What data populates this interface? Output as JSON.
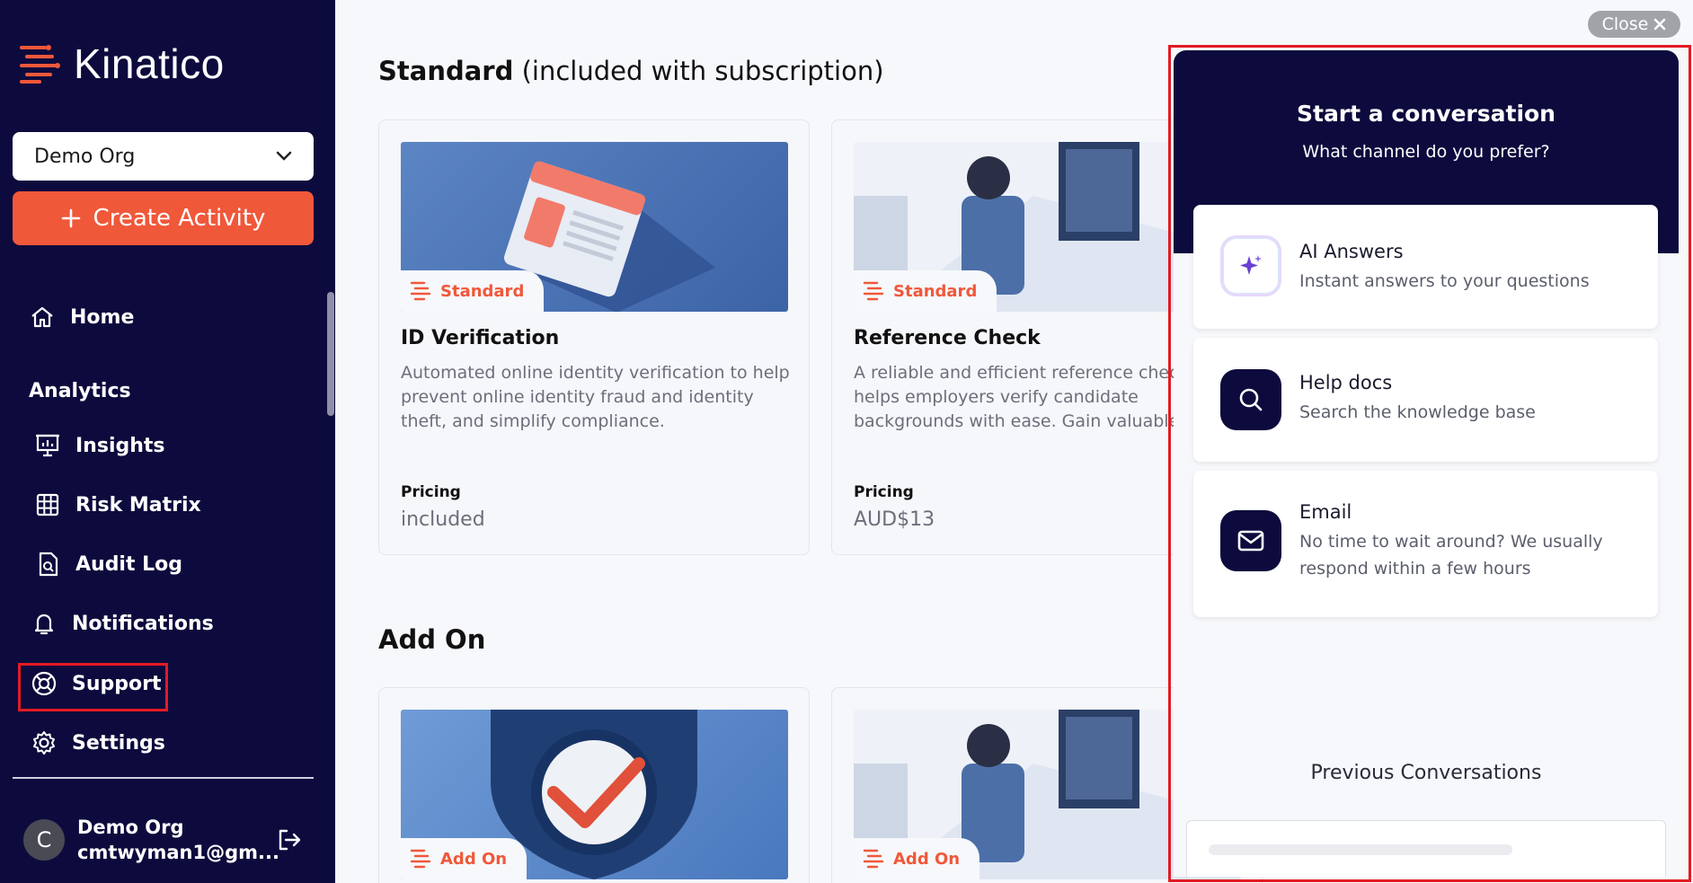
{
  "brand": {
    "name": "Kinatico"
  },
  "sidebar": {
    "org_select": {
      "value": "Demo Org"
    },
    "create_button": {
      "label": "Create Activity"
    },
    "home": {
      "label": "Home"
    },
    "analytics_section": "Analytics",
    "items": [
      {
        "label": "Insights",
        "icon": "presentation-chart-icon"
      },
      {
        "label": "Risk Matrix",
        "icon": "grid-icon"
      },
      {
        "label": "Audit Log",
        "icon": "document-search-icon"
      },
      {
        "label": "Notifications",
        "icon": "bell-icon"
      },
      {
        "label": "Support",
        "icon": "lifebuoy-icon"
      },
      {
        "label": "Settings",
        "icon": "gear-icon"
      }
    ],
    "user": {
      "initial": "C",
      "name": "Demo Org",
      "email": "cmtwyman1@gm..."
    }
  },
  "main": {
    "standard_section": {
      "title_bold": "Standard",
      "title_rest": " (included with subscription)"
    },
    "addon_section": {
      "title": "Add On"
    },
    "cards": [
      {
        "badge": "Standard",
        "title": "ID Verification",
        "description": "Automated online identity verification to help prevent online identity fraud and identity theft, and simplify compliance.",
        "pricing_label": "Pricing",
        "pricing_value": "included"
      },
      {
        "badge": "Standard",
        "title": "Reference Check",
        "description": "A reliable and efficient reference check that helps employers verify candidate backgrounds with ease. Gain valuable",
        "pricing_label": "Pricing",
        "pricing_value": "AUD$13"
      }
    ],
    "addon_cards": [
      {
        "badge": "Add On"
      },
      {
        "badge": "Add On"
      }
    ]
  },
  "close_button": {
    "label": "Close"
  },
  "panel": {
    "title": "Start a conversation",
    "subtitle": "What channel do you prefer?",
    "options": [
      {
        "title": "AI Answers",
        "description": "Instant answers to your questions",
        "icon": "sparkle-icon"
      },
      {
        "title": "Help docs",
        "description": "Search the knowledge base",
        "icon": "search-icon"
      },
      {
        "title": "Email",
        "description": "No time to wait around? We usually respond within a few hours",
        "icon": "envelope-icon"
      }
    ],
    "previous_title": "Previous Conversations"
  },
  "colors": {
    "sidebar": "#0d0b3d",
    "accent": "#f0583a",
    "highlight": "#e21b23"
  }
}
